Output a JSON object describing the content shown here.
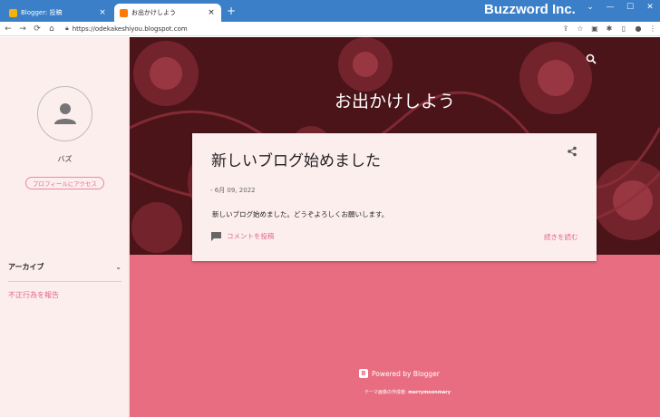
{
  "browser": {
    "tabs": [
      {
        "title": "Blogger: 投稿",
        "close": "×"
      },
      {
        "title": "お出かけしよう",
        "close": "×"
      }
    ],
    "new_tab": "+",
    "brand": "Buzzword Inc.",
    "window_controls": [
      "⌄",
      "—",
      "☐",
      "✕"
    ],
    "nav": {
      "back": "←",
      "forward": "→",
      "reload": "⟳",
      "home": "⌂"
    },
    "url": "https://odekakeshiyou.blogspot.com"
  },
  "sidebar": {
    "username": "バズ",
    "profile_button": "プロフィールにアクセス",
    "archive_label": "アーカイブ",
    "report_link": "不正行為を報告"
  },
  "blog": {
    "title": "お出かけしよう",
    "post": {
      "title": "新しいブログ始めました",
      "date": "- 6月 09, 2022",
      "body": "新しいブログ始めました。どうぞよろしくお願いします。",
      "comment_link": "コメントを投稿",
      "read_more": "続きを読む"
    },
    "footer": {
      "powered_by": "Powered by Blogger",
      "theme_credit_prefix": "テーマ画像の作成者: ",
      "theme_credit_author": "merrymoonmary"
    }
  },
  "colors": {
    "tabstrip": "#3a7fc8",
    "hero": "#4a1419",
    "accent": "#e86d81",
    "sidebar": "#fdeeee",
    "link": "#e06a88"
  },
  "icons": [
    "search-icon",
    "share-icon",
    "comment-icon",
    "chevron-down-icon",
    "avatar-person-icon",
    "blogger-icon",
    "lock-icon"
  ]
}
